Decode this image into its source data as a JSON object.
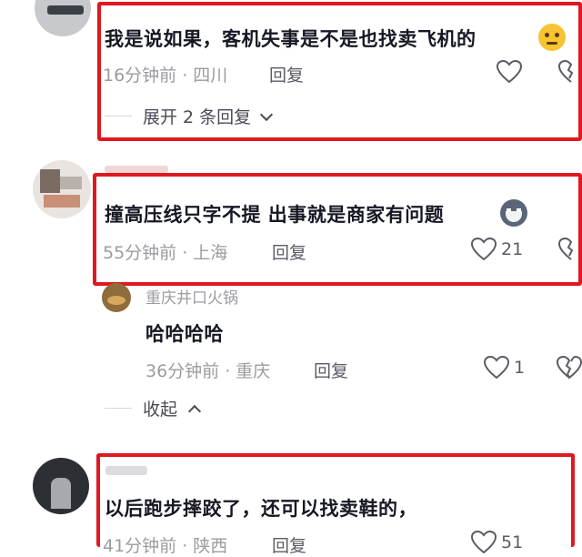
{
  "colors": {
    "highlight": "#e0181f",
    "meta": "#9b9ba3",
    "text": "#161823"
  },
  "comments": [
    {
      "text": "我是说如果，客机失事是不是也找卖飞机的",
      "emoji": "thinking-face",
      "meta": "16分钟前 · 四川",
      "reply": "回复",
      "expand": "展开 2 条回复"
    },
    {
      "text": "撞高压线只字不提 出事就是商家有问题",
      "emoji": "wolf-face",
      "meta": "55分钟前 · 上海",
      "reply": "回复",
      "likes": "21"
    },
    {
      "username": "重庆井口火锅",
      "text": "哈哈哈哈",
      "meta": "36分钟前 · 重庆",
      "reply": "回复",
      "likes": "1",
      "collapse": "收起"
    },
    {
      "text": "以后跑步摔跤了，还可以找卖鞋的，",
      "meta": "41分钟前 · 陕西",
      "reply": "回复",
      "likes": "51"
    }
  ]
}
